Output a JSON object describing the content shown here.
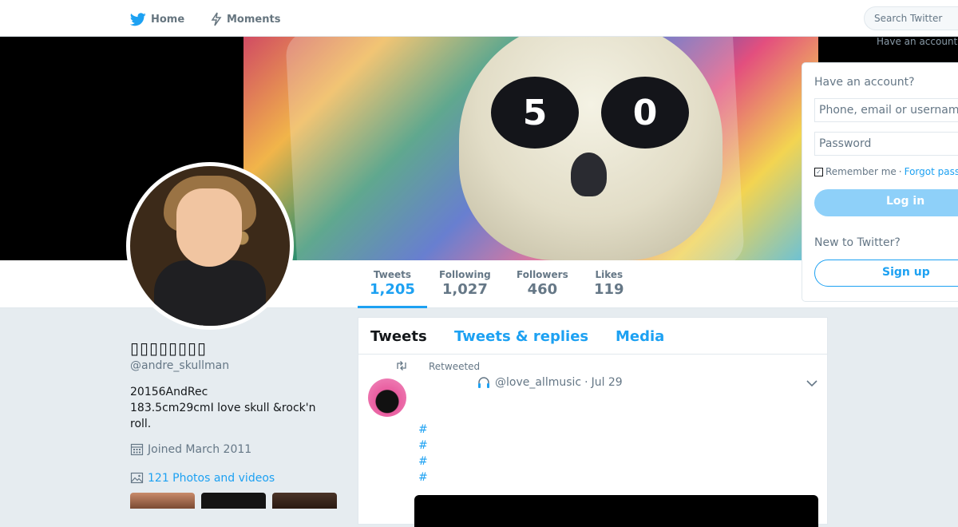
{
  "topbar": {
    "home_label": "Home",
    "moments_label": "Moments",
    "search_placeholder": "Search Twitter",
    "have_account_small": "Have an account"
  },
  "banner": {
    "eye_left_text": "5",
    "eye_right_text": "0"
  },
  "profile_nav": {
    "stats": [
      {
        "label": "Tweets",
        "value": "1,205"
      },
      {
        "label": "Following",
        "value": "1,027"
      },
      {
        "label": "Followers",
        "value": "460"
      },
      {
        "label": "Likes",
        "value": "119"
      }
    ]
  },
  "profile": {
    "name": "▯▯▯▯▯▯▯▯",
    "handle": "@andre_skullman",
    "bio_line1": "20156AndRec",
    "bio_line2": "183.5cm29cmI love skull &rock'n roll.",
    "joined": "Joined March 2011",
    "photos_link": "121 Photos and videos"
  },
  "timeline": {
    "tabs": [
      "Tweets",
      "Tweets & replies",
      "Media"
    ],
    "tweet": {
      "retweeted_label": "Retweeted",
      "author_handle": "@love_allmusic",
      "separator": "·",
      "date": "Jul 29",
      "hashtags": [
        "#",
        "#",
        "#",
        "#"
      ]
    }
  },
  "login_card": {
    "title": "Have an account?",
    "username_placeholder": "Phone, email or username",
    "password_placeholder": "Password",
    "remember_label": "Remember me",
    "separator": "·",
    "forgot_label": "Forgot password?",
    "login_button": "Log in",
    "new_to_twitter": "New to Twitter?",
    "signup_button": "Sign up"
  },
  "colors": {
    "accent": "#1da1f2",
    "background": "#e6ecf0",
    "muted_text": "#657786"
  }
}
